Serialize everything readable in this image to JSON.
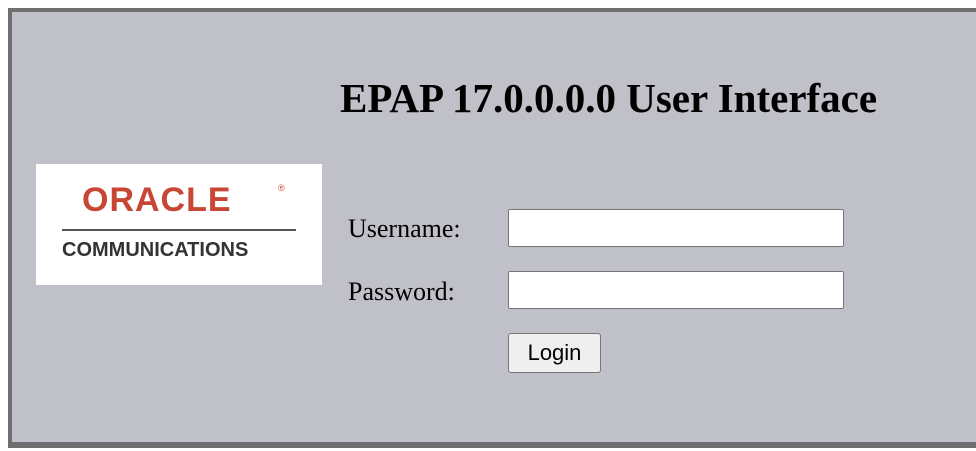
{
  "page": {
    "title": "EPAP 17.0.0.0.0 User Interface"
  },
  "logo": {
    "brand": "ORACLE",
    "registered_mark": "®",
    "subtitle": "COMMUNICATIONS"
  },
  "form": {
    "username_label": "Username:",
    "username_value": "",
    "password_label": "Password:",
    "password_value": "",
    "login_label": "Login"
  },
  "colors": {
    "panel_background": "#c0c0c8",
    "frame_border": "#6f6f6f",
    "oracle_red": "#c74634"
  }
}
